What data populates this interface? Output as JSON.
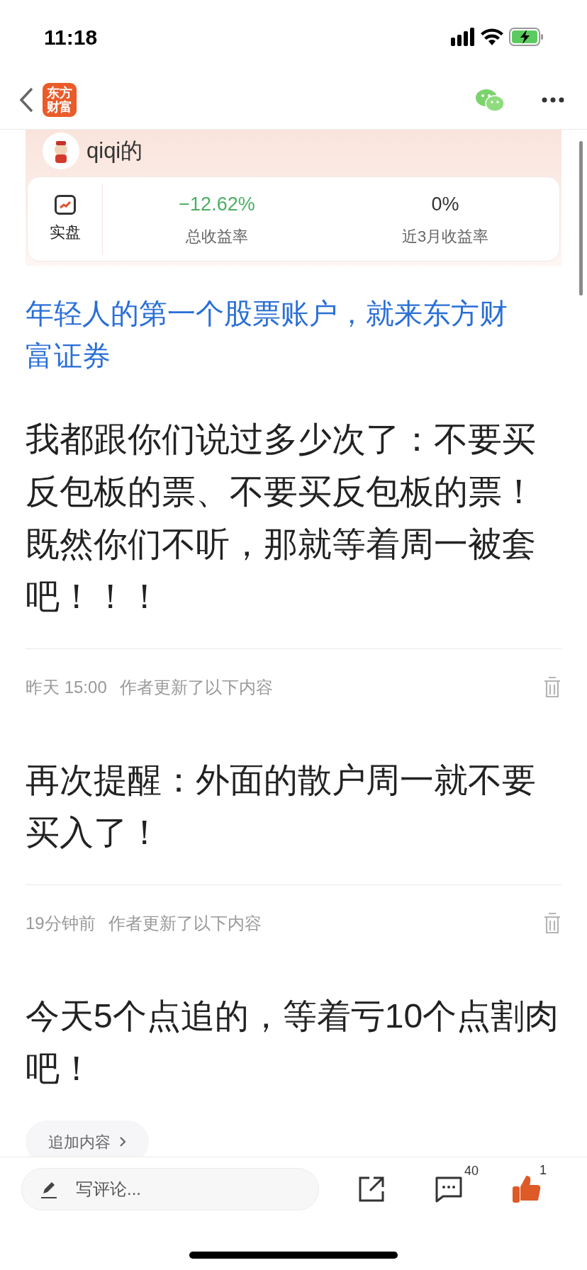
{
  "status_bar": {
    "time": "11:18"
  },
  "nav": {
    "logo_lines": [
      "东方",
      "财富"
    ]
  },
  "author": {
    "name": "qiqi的"
  },
  "portfolio": {
    "label": "实盘",
    "stats": [
      {
        "value": "−12.62%",
        "label": "总收益率",
        "color": "#4caf64"
      },
      {
        "value": "0%",
        "label": "近3月收益率",
        "color": "#333333"
      }
    ]
  },
  "promo_link": "年轻人的第一个股票账户，就来东方财富证券",
  "post": {
    "text": "我都跟你们说过多少次了：不要买反包板的票、不要买反包板的票！既然你们不听，那就等着周一被套吧！！！"
  },
  "updates": [
    {
      "time": "昨天 15:00",
      "note": "作者更新了以下内容",
      "text": "再次提醒：外面的散户周一就不要买入了！"
    },
    {
      "time": "19分钟前",
      "note": "作者更新了以下内容",
      "text": "今天5个点追的，等着亏10个点割肉吧！"
    }
  ],
  "add_content_button": "追加内容",
  "bottom_bar": {
    "comment_placeholder": "写评论...",
    "comment_count": "40",
    "like_count": "1",
    "liked": true
  }
}
